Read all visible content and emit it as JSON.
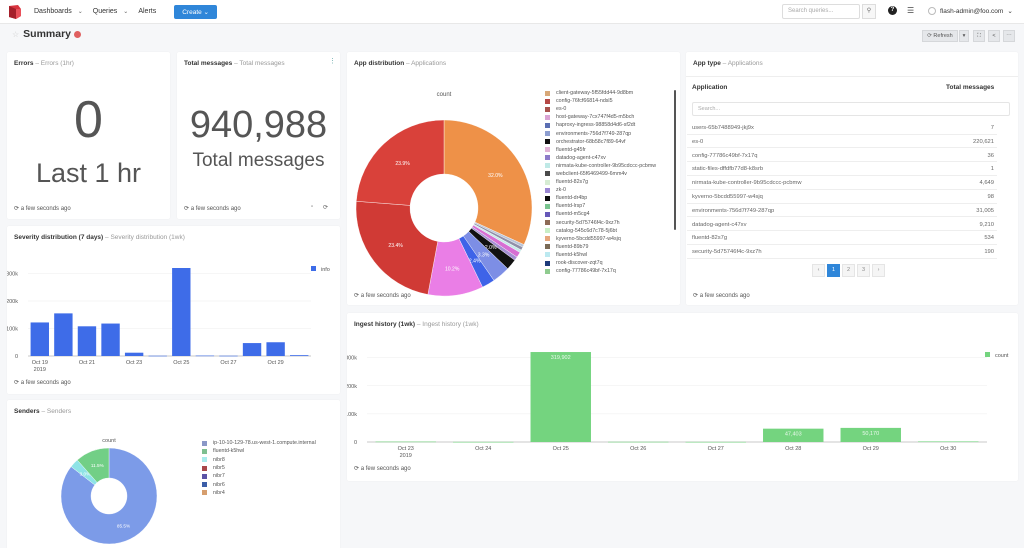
{
  "nav": {
    "items": [
      {
        "label": "Dashboards",
        "has_dropdown": true
      },
      {
        "label": "Queries",
        "has_dropdown": true
      },
      {
        "label": "Alerts",
        "has_dropdown": false
      }
    ],
    "create_label": "Create ⌄",
    "search_placeholder": "Search queries...",
    "search_icon": "search-icon",
    "user": "flash-admin@foo.com",
    "user_chevron": "⌄"
  },
  "page": {
    "title": "Summary",
    "refresh_label": "⟳ Refresh",
    "dropdown": "▾",
    "fullscreen": "⛶",
    "share": "<",
    "more": "⋯"
  },
  "panels": {
    "errors": {
      "title": "Errors",
      "subtitle": "Errors (1hr)",
      "value": "0",
      "caption": "Last 1 hr",
      "footer": "⟳ a few seconds ago"
    },
    "total": {
      "title": "Total messages",
      "subtitle": "Total messages",
      "value": "940,988",
      "caption": "Total messages",
      "footer": "⟳ a few seconds ago",
      "kebab": "⋮"
    },
    "app_dist": {
      "title": "App distribution",
      "subtitle": "Applications",
      "footer": "⟳ a few seconds ago"
    },
    "app_type": {
      "title": "App type",
      "subtitle": "Applications",
      "col_app": "Application",
      "col_total": "Total messages",
      "search_placeholder": "Search...",
      "rows": [
        {
          "app": "users-65b7488949-jkj9x",
          "total": "7"
        },
        {
          "app": "es-0",
          "total": "220,621"
        },
        {
          "app": "config-77786c49bf-7x17q",
          "total": "36"
        },
        {
          "app": "static-files-dffdfb77d8-k8srb",
          "total": "1"
        },
        {
          "app": "nirmata-kube-controller-9b95cdccc-pcbmw",
          "total": "4,649"
        },
        {
          "app": "kyverno-5bcdd55997-w4sjq",
          "total": "98"
        },
        {
          "app": "environments-756d7f749-287qp",
          "total": "31,005"
        },
        {
          "app": "datadog-agent-c47xv",
          "total": "9,210"
        },
        {
          "app": "fluentd-82s7g",
          "total": "534"
        },
        {
          "app": "security-5d75746f4c-9xz7h",
          "total": "190"
        }
      ],
      "pages": [
        "‹",
        "1",
        "2",
        "3",
        "›"
      ],
      "active_page": "1",
      "footer": "⟳ a few seconds ago"
    },
    "severity": {
      "title": "Severity distribution (7 days)",
      "subtitle": "Severity distribution (1wk)",
      "footer": "⟳ a few seconds ago"
    },
    "ingest": {
      "title": "Ingest history (1wk)",
      "subtitle": "Ingest history (1wk)",
      "footer": "⟳ a few seconds ago"
    },
    "senders": {
      "title": "Senders",
      "subtitle": "Senders"
    }
  },
  "chart_data": [
    {
      "id": "app_distribution",
      "type": "pie",
      "donut": true,
      "title": "count",
      "slices": [
        {
          "label": "client-gateway-5f55fdd44-9d8bm",
          "value": 32.0,
          "color": "#ee9148",
          "data_label": "32.0%"
        },
        {
          "label": "fluentd-g45fr",
          "value": 0.5,
          "color": "#b9c3d6"
        },
        {
          "label": "datadog-agent-c47xv",
          "value": 0.6,
          "color": "#8f8fa8"
        },
        {
          "label": "nirmata-kube-controller-9b95cdccc-pcbmw",
          "value": 0.5,
          "color": "#c7ebe9"
        },
        {
          "label": "fluentd-82s7g",
          "value": 1.0,
          "color": "#d76fd3"
        },
        {
          "label": "webclient-65f6469499-6mm4v",
          "value": 0.7,
          "color": "#a58fd4"
        },
        {
          "label": "orchestrator-68b58c7f89-64vf",
          "value": 2.0,
          "color": "#111111",
          "data_label": "2.0%"
        },
        {
          "label": "environments-756d7f749-287qp",
          "value": 3.3,
          "color": "#7d8ee5",
          "data_label": "3.3%"
        },
        {
          "label": "haproxy-ingress-98858d4d6-sf2dt",
          "value": 2.4,
          "color": "#3e63e8",
          "data_label": "2.4%"
        },
        {
          "label": "host-gateway-7cx747f4d5-m5bch",
          "value": 10.2,
          "color": "#ea7ee6",
          "data_label": "10.2%"
        },
        {
          "label": "es-0",
          "value": 23.4,
          "color": "#d03a35",
          "data_label": "23.4%"
        },
        {
          "label": "config-76fcf66814-ndsl5",
          "value": 23.9,
          "color": "#d9413a",
          "data_label": "23.9%"
        }
      ],
      "legend": [
        {
          "label": "client-gateway-5f55fdd44-9d8bm",
          "color": "#d8a878"
        },
        {
          "label": "config-76fcf66814-ndsl5",
          "color": "#b54845"
        },
        {
          "label": "es-0",
          "color": "#a7524d"
        },
        {
          "label": "host-gateway-7cx747f4d5-m5bch",
          "color": "#d9a3d4"
        },
        {
          "label": "haproxy-ingress-98858d4d6-sf2dt",
          "color": "#5b6fb3"
        },
        {
          "label": "environments-756d7f749-287qp",
          "color": "#8d9ed0"
        },
        {
          "label": "orchestrator-68b58c7f89-64vf",
          "color": "#111111"
        },
        {
          "label": "fluentd-g45fr",
          "color": "#e0b2d6"
        },
        {
          "label": "datadog-agent-c47xv",
          "color": "#8d7bc9"
        },
        {
          "label": "nirmata-kube-controller-9b95cdccc-pcbmw",
          "color": "#bfe9e6"
        },
        {
          "label": "webclient-65f6469499-6mm4v",
          "color": "#4a4a4a"
        },
        {
          "label": "fluentd-82s7g",
          "color": "#d6ecd3"
        },
        {
          "label": "zk-0",
          "color": "#9a86d2"
        },
        {
          "label": "fluentd-dr4bp",
          "color": "#0b0b0b"
        },
        {
          "label": "fluentd-lrsp7",
          "color": "#79c48f"
        },
        {
          "label": "fluentd-m5cg4",
          "color": "#6658b8"
        },
        {
          "label": "security-5d75746f4c-9xz7h",
          "color": "#8d6a56"
        },
        {
          "label": "catalog-545c6d7c78-5j6bt",
          "color": "#c9eec6"
        },
        {
          "label": "kyverno-5bcdd55997-w4sjq",
          "color": "#e6a67c"
        },
        {
          "label": "fluentd-89b79",
          "color": "#7a6a56"
        },
        {
          "label": "fluentd-k5hwl",
          "color": "#bce9f0"
        },
        {
          "label": "rook-discover-zqt7q",
          "color": "#1e3b7a"
        },
        {
          "label": "config-77786c49bf-7x17q",
          "color": "#8fcb8f"
        }
      ]
    },
    {
      "id": "severity_distribution",
      "type": "bar",
      "categories": [
        "Oct 19",
        "Oct 20",
        "Oct 21",
        "Oct 22",
        "Oct 23",
        "Oct 24",
        "Oct 25",
        "Oct 26",
        "Oct 27",
        "Oct 28",
        "Oct 29",
        "Oct 30"
      ],
      "tick_labels": [
        "Oct 19\n2019",
        "",
        "Oct 21",
        "",
        "Oct 23",
        "",
        "Oct 25",
        "",
        "Oct 27",
        "",
        "Oct 29",
        ""
      ],
      "series": [
        {
          "name": "info",
          "color": "#3e6ce8",
          "values": [
            122000,
            155000,
            108000,
            118000,
            12000,
            1000,
            320000,
            1500,
            1000,
            47000,
            50000,
            3000
          ]
        }
      ],
      "ylim": [
        0,
        320000
      ],
      "yticks": [
        0,
        100000,
        200000,
        300000
      ],
      "ytick_labels": [
        "0",
        "100k",
        "200k",
        "300k"
      ],
      "legend": "top-right",
      "grid": true
    },
    {
      "id": "ingest_history",
      "type": "bar",
      "categories": [
        "Oct 23",
        "Oct 24",
        "Oct 25",
        "Oct 26",
        "Oct 27",
        "Oct 28",
        "Oct 29",
        "Oct 30"
      ],
      "tick_labels": [
        "Oct 23\n2019",
        "Oct 24",
        "Oct 25",
        "Oct 26",
        "Oct 27",
        "Oct 28",
        "Oct 29",
        "Oct 30"
      ],
      "series": [
        {
          "name": "count",
          "color": "#74d47f",
          "values": [
            1500,
            500,
            319902,
            800,
            500,
            47403,
            50170,
            2000
          ]
        }
      ],
      "data_labels": [
        "",
        "",
        "319,902",
        "",
        "",
        "47,403",
        "50,170",
        ""
      ],
      "ylim": [
        0,
        320000
      ],
      "yticks": [
        0,
        100000,
        200000,
        300000
      ],
      "ytick_labels": [
        "0",
        "100k",
        "200k",
        "300k"
      ],
      "legend": "top-right",
      "grid": true
    },
    {
      "id": "senders",
      "type": "pie",
      "donut": true,
      "title": "count",
      "slices": [
        {
          "label": "ip-10-10-129-78.us-west-1.compute.internal",
          "value": 85.5,
          "color": "#7c9be8",
          "data_label": "85.5%"
        },
        {
          "label": "nibr8",
          "value": 3.0,
          "color": "#8ee3e6",
          "data_label": "3.0%"
        },
        {
          "label": "fluentd-k5hwl",
          "value": 11.5,
          "color": "#72cf86",
          "data_label": "11.5%"
        }
      ],
      "legend": [
        {
          "label": "ip-10-10-129-78.us-west-1.compute.internal",
          "color": "#8a98c7"
        },
        {
          "label": "fluentd-k5hwl",
          "color": "#7ebf90"
        },
        {
          "label": "nibr8",
          "color": "#a9ecec"
        },
        {
          "label": "nibr5",
          "color": "#a8474a"
        },
        {
          "label": "nibr7",
          "color": "#5b53a6"
        },
        {
          "label": "nibr6",
          "color": "#3b5ea8"
        },
        {
          "label": "nibr4",
          "color": "#d69e6e"
        }
      ]
    }
  ]
}
